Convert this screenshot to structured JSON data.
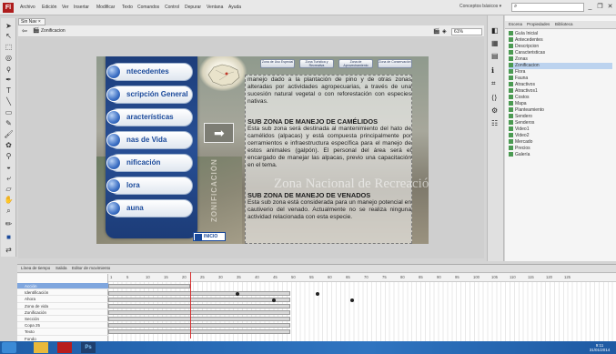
{
  "app": {
    "logo": "Fl"
  },
  "menu": [
    "Archivo",
    "Edición",
    "Ver",
    "Insertar",
    "Modificar",
    "Texto",
    "Comandos",
    "Control",
    "Depurar",
    "Ventana",
    "Ayuda"
  ],
  "workspace": "Conceptos básicos ▾",
  "search_icon": "search-icon",
  "window_controls": [
    "_",
    "❐",
    "✕"
  ],
  "document": {
    "tab": "Sin Nav ×",
    "scene": "Zonificacion",
    "zoom": "61%"
  },
  "slide": {
    "nav_buttons": [
      "Antecedentes",
      "Descripción General",
      "Características",
      "Zonas de Vida",
      "Zonificación",
      "Flora",
      "Fauna"
    ],
    "nav_partial": [
      "ntecedentes",
      "scripción General",
      "aracterísticas",
      "nas de Vida",
      "nificación",
      "lora",
      "auna"
    ],
    "top_buttons": [
      "Zona de Uso Especial",
      "Zona Turística y Recreativa",
      "Zona de Aprovechamiento",
      "Zona de Conservación"
    ],
    "vertical_label": "ZONIFICACIÓN",
    "inicio": "INICIO",
    "watermark": "Zona Nacional de Recreación",
    "para1": "manejo dado a la plantación de pino y de otras zonas alteradas por actividades agropecuarias, a través de una sucesión natural vegetal o con reforestación con especies nativas.",
    "heading1": "SUB ZONA DE MANEJO DE CAMÉLIDOS",
    "para2": "Esta sub zona será destinada al mantenimiento del hato de camélidos (alpacas) y está compuesta principalmente por cerramientos e infraestructura específica para el manejo de estos animales (galpón). El personal del área será el encargado de manejar las alpacas, previo una capacitación en el tema.",
    "heading2": "SUB ZONA DE MANEJO DE VENADOS",
    "para3": "Esta sub zona está considerada para un manejo potencial en cautiverio del venado. Actualmente no se realiza ninguna actividad relacionada con esta especie."
  },
  "panel": {
    "tabs": [
      "Escena",
      "Propiedades",
      "Biblioteca"
    ],
    "items": [
      "Guía Inicial",
      "Antecedentes",
      "Descripcion",
      "Caracteristicas",
      "Zonas",
      "Zonificacion",
      "Flora",
      "Fauna",
      "Atractivos",
      "Atractivos1",
      "Costos",
      "Mapa",
      "Planteamiento",
      "Sendero",
      "Senderos",
      "Video1",
      "Video2",
      "Mercado",
      "Precios",
      "Galería"
    ],
    "selected": 5
  },
  "timeline": {
    "tabs": [
      "Línea de tiempo",
      "Salida",
      "Editor de movimiento"
    ],
    "ruler": [
      "1",
      "5",
      "10",
      "15",
      "20",
      "25",
      "30",
      "35",
      "40",
      "45",
      "50",
      "55",
      "60",
      "65",
      "70",
      "75",
      "80",
      "85",
      "90",
      "95",
      "100",
      "105",
      "110",
      "115",
      "120",
      "125"
    ],
    "layers": [
      "Acción",
      "Identificación",
      "Ahora",
      "Zona de vida",
      "Zonificación",
      "Sección",
      "Copa 25",
      "Texto",
      "Fondo"
    ],
    "active": 0,
    "current_frame": 31
  },
  "taskbar": {
    "time": "9:11",
    "date": "31/01/2014"
  }
}
